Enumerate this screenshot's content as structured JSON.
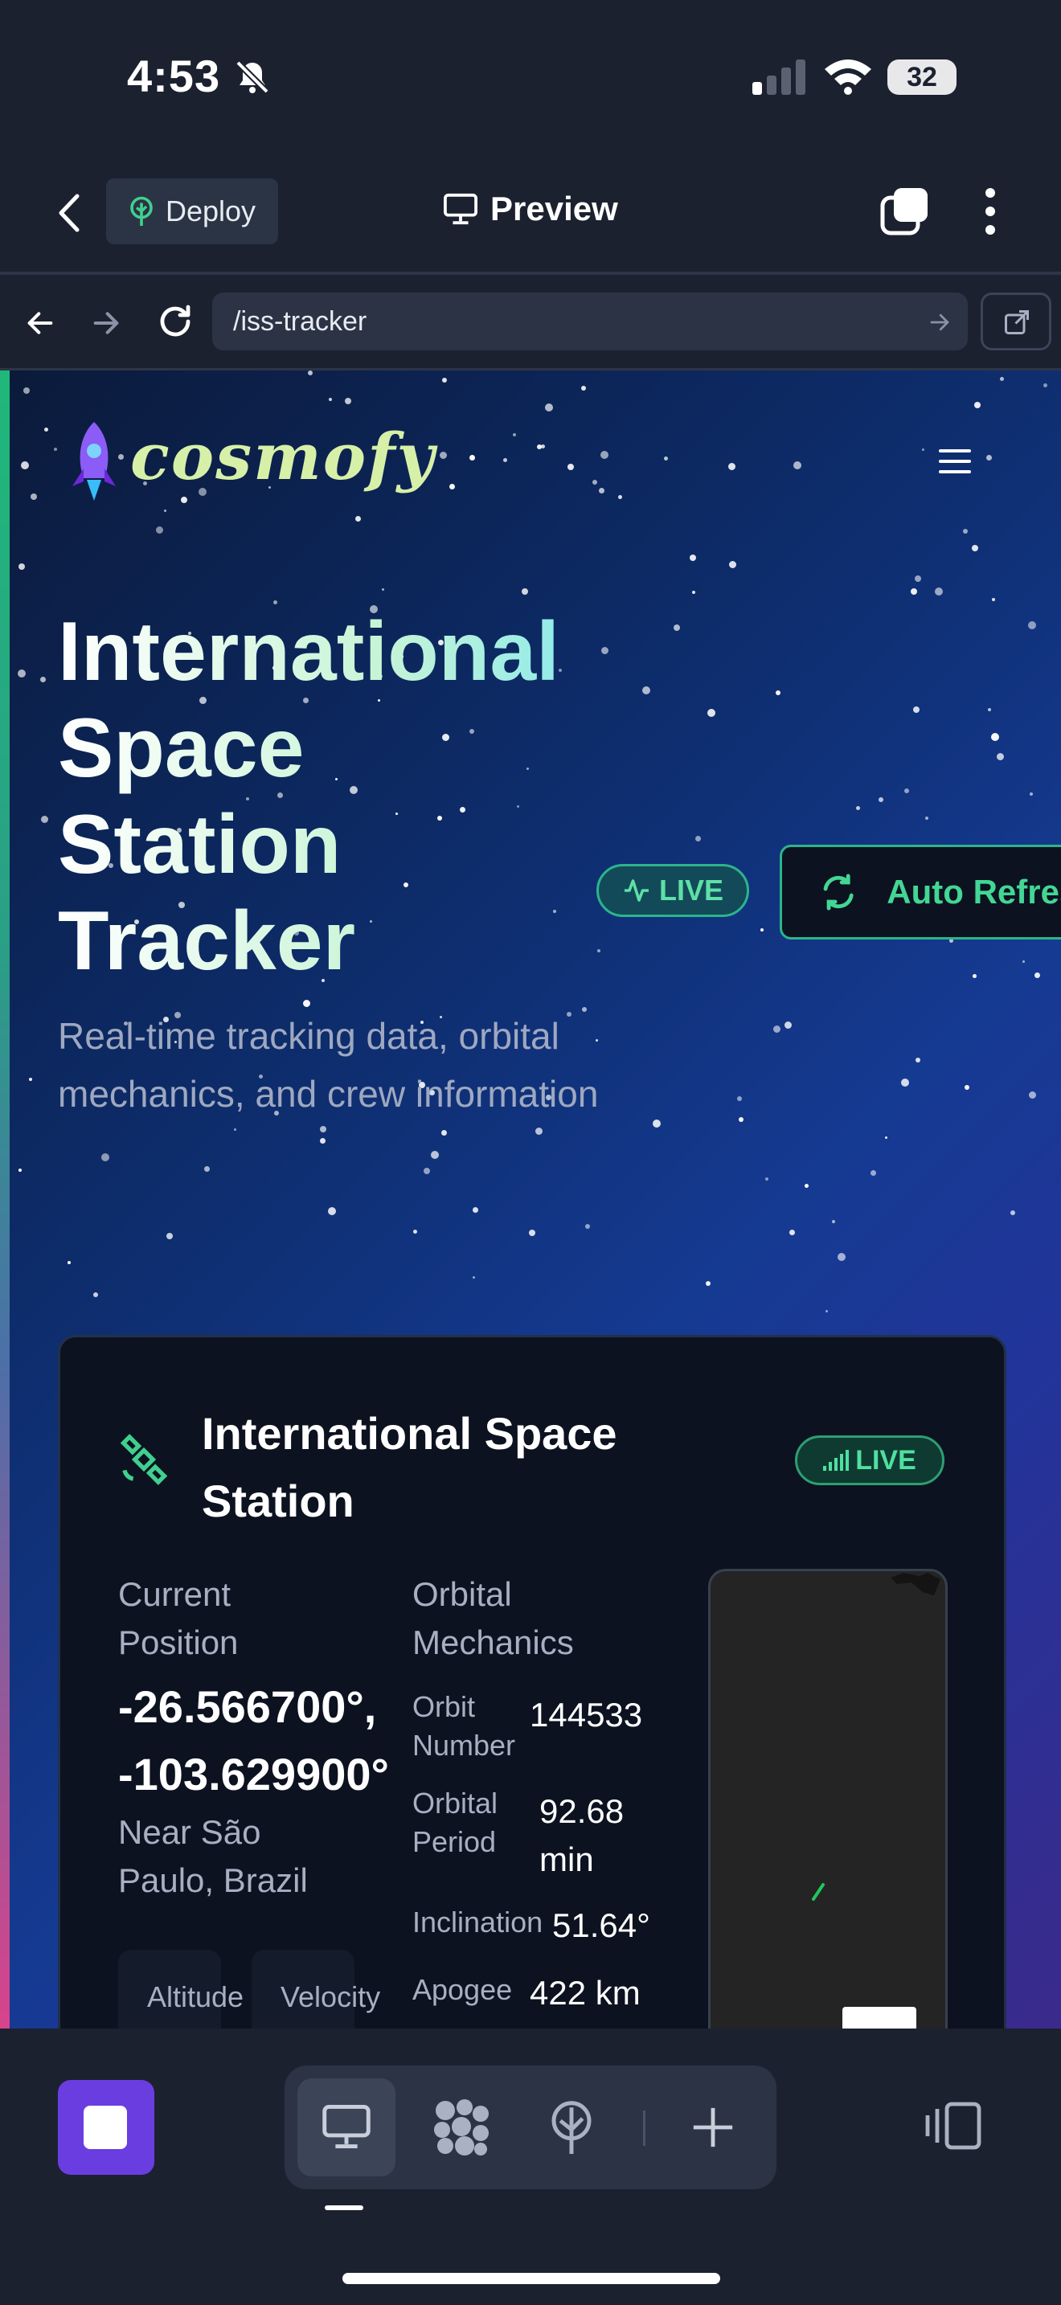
{
  "status_bar": {
    "time": "4:53",
    "battery": "32"
  },
  "toolbar": {
    "deploy_label": "Deploy",
    "preview_label": "Preview"
  },
  "browser": {
    "url": "/iss-tracker"
  },
  "site": {
    "logo": "cosmofy"
  },
  "hero": {
    "title_lines": [
      "International",
      "Space",
      "Station",
      "Tracker"
    ],
    "subtitle": "Real-time tracking data, orbital mechanics, and crew information",
    "live_label": "LIVE",
    "auto_refresh_label": "Auto Refresh"
  },
  "card": {
    "title": "International Space Station",
    "live_label": "LIVE",
    "current_position_label": "Current Position",
    "coordinates": "-26.566700°, -103.629900°",
    "coord_lat": "-26.566700°,",
    "coord_lon": "-103.629900°",
    "near_location": "Near São Paulo, Brazil",
    "orbital_mechanics_label": "Orbital Mechanics",
    "orbital": [
      {
        "label": "Orbit Number",
        "value": "144533"
      },
      {
        "label": "Orbital Period",
        "value": "92.68 min"
      },
      {
        "label": "Inclination",
        "value": "51.64°"
      },
      {
        "label": "Apogee",
        "value": "422 km"
      }
    ],
    "mini_stats": [
      {
        "label": "Altitude"
      },
      {
        "label": "Velocity"
      }
    ]
  },
  "icons": {
    "status": [
      "bell-muted-icon",
      "signal-icon",
      "wifi-icon"
    ],
    "toolbar": [
      "back-chevron-icon",
      "deploy-tree-icon",
      "monitor-icon",
      "tabs-icon",
      "more-vertical-icon"
    ],
    "bottom": [
      "stop-icon",
      "desktop-icon",
      "components-icon",
      "deploy-tree-icon",
      "plus-icon",
      "layout-icon"
    ]
  },
  "colors": {
    "accent_green": "#43d694",
    "stop_purple": "#6a3de0",
    "app_bg": "#1c2130"
  }
}
